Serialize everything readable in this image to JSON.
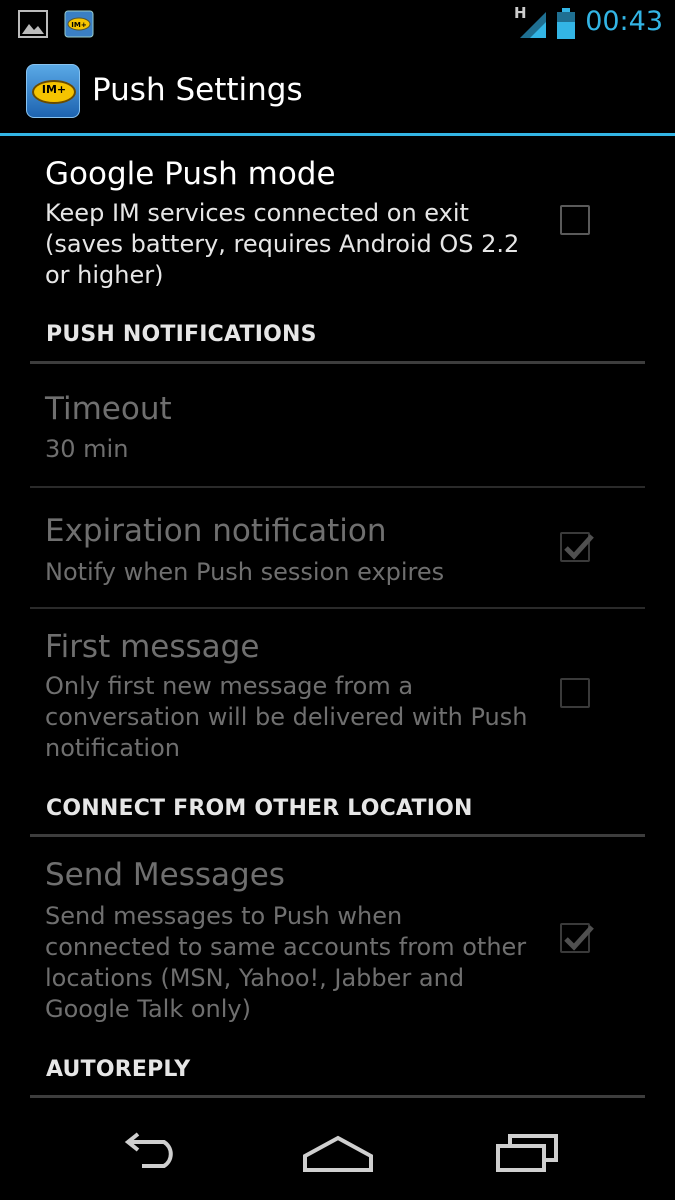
{
  "status_bar": {
    "time": "00:43",
    "network_type": "H",
    "icons": [
      "gallery-icon",
      "im-plus-icon",
      "signal-icon",
      "battery-icon"
    ]
  },
  "action_bar": {
    "title": "Push Settings",
    "app_icon_text": "IM+"
  },
  "preferences": {
    "google_push": {
      "title": "Google Push mode",
      "summary": "Keep IM services connected on exit (saves battery, requires Android OS 2.2 or higher)",
      "checked": false,
      "enabled": true
    },
    "cat_push_notifications": "PUSH NOTIFICATIONS",
    "timeout": {
      "title": "Timeout",
      "summary": "30 min",
      "enabled": false
    },
    "expiration": {
      "title": "Expiration notification",
      "summary": "Notify when Push session expires",
      "checked": true,
      "enabled": false
    },
    "first_message": {
      "title": "First message",
      "summary": "Only first new message from a conversation will be delivered with Push notification",
      "checked": false,
      "enabled": false
    },
    "cat_connect_other": "CONNECT FROM OTHER LOCATION",
    "send_messages": {
      "title": "Send Messages",
      "summary": "Send messages to Push when connected to same accounts from other locations (MSN, Yahoo!, Jabber and Google Talk only)",
      "checked": true,
      "enabled": false
    },
    "cat_autoreply": "AUTOREPLY"
  },
  "nav_bar": {
    "buttons": [
      "back-icon",
      "home-icon",
      "recent-apps-icon"
    ]
  },
  "colors": {
    "accent": "#33b5e5",
    "background": "#000000",
    "disabled_text": "#6f6f6f"
  }
}
